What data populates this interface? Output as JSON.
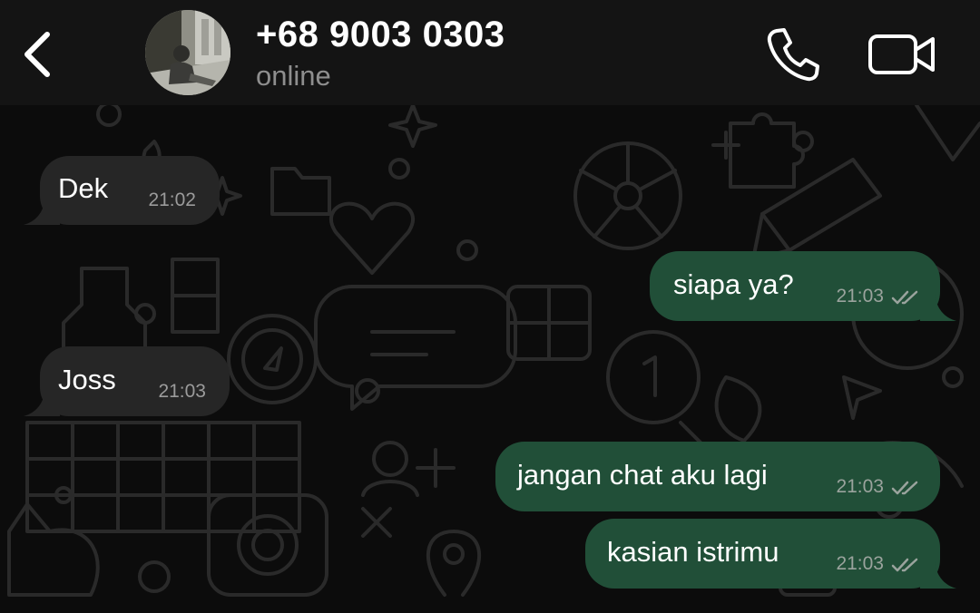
{
  "header": {
    "contact_name": "+68 9003 0303",
    "status": "online"
  },
  "messages": [
    {
      "direction": "incoming",
      "text": "Dek",
      "time": "21:02"
    },
    {
      "direction": "outgoing",
      "text": "siapa ya?",
      "time": "21:03",
      "status": "read"
    },
    {
      "direction": "incoming",
      "text": "Joss",
      "time": "21:03"
    },
    {
      "direction": "outgoing",
      "text": "jangan chat aku lagi",
      "time": "21:03",
      "status": "read"
    },
    {
      "direction": "outgoing",
      "text": "kasian istrimu",
      "time": "21:03",
      "status": "read"
    }
  ],
  "icons": {
    "back": "chevron-left-icon",
    "call": "phone-icon",
    "video": "video-camera-icon",
    "read_receipt": "double-check-icon"
  },
  "colors": {
    "header_bg": "#141414",
    "chat_bg": "#0c0c0c",
    "incoming_bubble": "#262626",
    "outgoing_bubble": "#214f38",
    "text": "#ffffff",
    "meta_text": "#9b9b9b"
  }
}
